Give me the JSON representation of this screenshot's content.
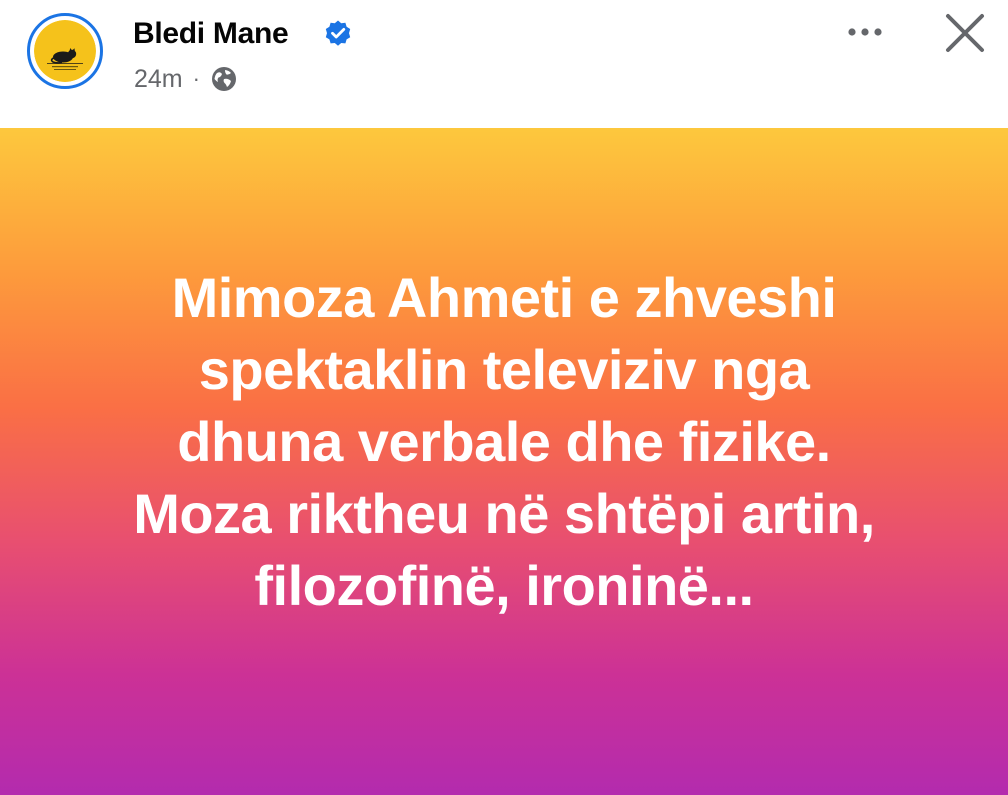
{
  "author": {
    "name": "Bledi Mane",
    "verified_icon": "verified-badge-icon",
    "avatar_icon": "sleeping-cat-logo"
  },
  "meta": {
    "time": "24m",
    "separator": "·",
    "privacy_icon": "globe-icon"
  },
  "actions": {
    "more_icon": "more-options-icon",
    "close_icon": "close-icon"
  },
  "post": {
    "text": "Mimoza Ahmeti e zhveshi\nspektaklin televiziv nga\ndhuna verbale dhe fizike.\nMoza riktheu në shtëpi artin,\nfilozofinë, ironinë...",
    "gradient": [
      "#fdc83d",
      "#fd9a3c",
      "#fa6f45",
      "#e84f70",
      "#cc3196",
      "#b32bae"
    ]
  },
  "colors": {
    "accent": "#1b74e4",
    "avatar_bg": "#f5c21b"
  }
}
